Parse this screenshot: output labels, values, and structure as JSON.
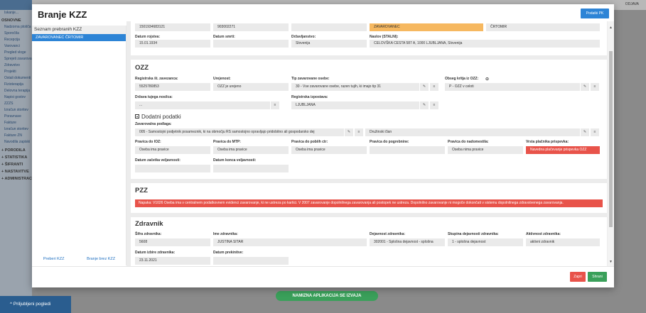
{
  "background": {
    "sidebar_head": "Iskanje...",
    "sidebar_items": [
      "OSNOVNE",
      "Nadzorna plošča",
      "Sporočila",
      "Recepcija",
      "Varovanci",
      "Pregled vloge",
      "Sprejeti zavarovanci",
      "Zdravstvo",
      "Projekti",
      "Ostali dokumenti",
      "Fizioterapija",
      "Delovna terapija",
      "Napisi gostov",
      "ZZZS",
      "Izračun storitev",
      "Poravnave",
      "Fakture",
      "Izračun storitev",
      "Fakture ZN",
      "Navodila zapiski"
    ],
    "sidebar_groups": [
      "+ PORODILA",
      "+ STATISTIKA",
      "+ ŠIFRANTI",
      "+ NASTAVITVE",
      "+ ADMINISTRACIJA"
    ],
    "top_right": "ODJAVA",
    "bottom_left": "^ Priljubljeni pogledi",
    "namizna": "NAMIZNA APLIKACIJA SE IZVAJA"
  },
  "modal": {
    "title": "Branje KZZ",
    "podatki_btn": "Podatki PK",
    "left_header": "Seznam prebranih KZZ",
    "left_item": "ZAVAROVANEC ČRTOMIR",
    "left_foot": [
      "Preberi KZZ",
      "Branje brez KZZ"
    ],
    "zapri": "Zapri",
    "shrani": "Shrani"
  },
  "top_section": {
    "values_row1": [
      "1501934683121",
      "903002271",
      "ZAVAROVANEC",
      "ČRTOMIR"
    ],
    "labels_row2": [
      "Datum rojstva:",
      "Datum smrti:",
      "Državljanstvo:",
      "Naslov (STALNI):"
    ],
    "values_row2": [
      "15.01.1934",
      "",
      "Slovenija",
      "CELOVŠKA CESTA 587 A, 1000 LJUBLJANA, Slovenija"
    ]
  },
  "ozz": {
    "title": "OZZ",
    "labels": [
      "Registrska št. zavezanca:",
      "Urejenost:",
      "Tip zavarovane osebe:",
      "Obseg kritja iz OZZ:"
    ],
    "values": [
      "5525780853",
      "OZZ je urejeno",
      "30 - Vse zavarovane osebe, razen tujih, ki imajo tip 31",
      "P - OZZ v celoti"
    ],
    "labels2": [
      "Država tujega nosilca:",
      "Registrska izpostava:"
    ],
    "values2": [
      "...",
      "LJUBLJANA"
    ],
    "dodatni": "Dodatni podatki",
    "podlaga_label": "Zavarovalna podlaga:",
    "podlaga_value": "005 - Samostojni podjetnik posameznik, ki na območju RS samostojno opravljajo pridobitno ali gospodarsko dej",
    "podlaga_value2": "Družinski član",
    "pravica_labels": [
      "Pravica do IOZ:",
      "Pravica do MTP:",
      "Pravica do pobiih ctr:",
      "Pravica do pogrebnine:",
      "Pravica do nadomestila:",
      "Vrsta plačnika prispevka:"
    ],
    "pravica_values": [
      "Oseba ima pravice",
      "Oseba ima pravice",
      "Oseba ima pravice",
      "",
      "Oseba nima pravice",
      "Navedna plačevanje prispevka OZZ"
    ],
    "datum_labels": [
      "Datum začetka veljavnosti:",
      "Datum konca veljavnosti:"
    ],
    "datum_values": [
      "",
      ""
    ]
  },
  "pzz": {
    "title": "PZZ",
    "alert": "Napaka: V1026 Oseba ima v centralnem podatkovnem evidenci zavarovanje, ki ne ustreza po kartici. V 2007 zavarovanje dopolnilnega zavarovanja ali postopek ne ustreza. Dopolnilno zavarovanje ni mogoče dokončati v sistemu dopolnilnega zdravstvenega zavarovanja."
  },
  "zdravnik": {
    "title": "Zdravnik",
    "labels": [
      "Šifra zdravnika:",
      "Ime zdravnika:",
      "Dejavnost zdravnika:",
      "Skupina dejavnosti zdravnika:",
      "Aktivnost zdravnika:"
    ],
    "values": [
      "5608",
      "JUSTINA SITAR",
      "302001 - Splošna dejavnost - splošna",
      "1 - splošna dejavnost",
      "aktivni zdravnik"
    ],
    "labels2": [
      "Datum izbire zdravnika:",
      "Datum prekinitve:"
    ],
    "values2": [
      "23.11.2021",
      ""
    ]
  },
  "colors": {
    "accent": "#2d84d6",
    "orange": "#f6b860",
    "danger": "#e8534a",
    "success": "#3aa05a"
  },
  "icons": [
    "pencil-icon",
    "list-icon",
    "info-icon",
    "minus-box-icon",
    "scroll-up-icon",
    "scroll-down-icon"
  ]
}
